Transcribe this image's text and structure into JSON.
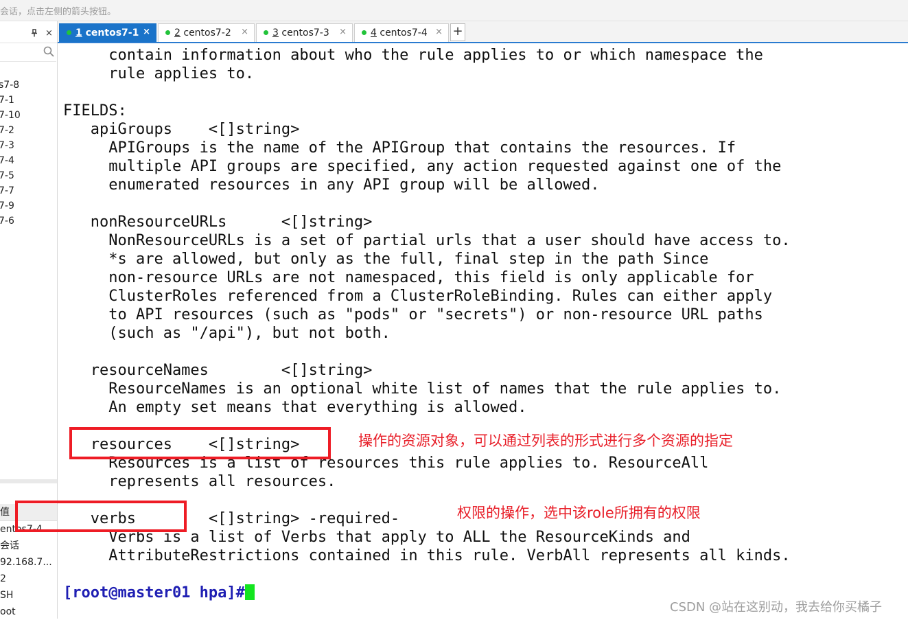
{
  "top_hint": "会话，点击左侧的箭头按钮。",
  "sidebar": {
    "pin_icon": "pin-icon",
    "close_label": "×",
    "search_icon": "search-icon",
    "items": [
      "s7-8",
      "7-1",
      "7-10",
      "7-2",
      "7-3",
      "7-4",
      "7-5",
      "7-7",
      "7-9",
      "7-6"
    ],
    "properties": [
      "值",
      "entos7-4",
      "会话",
      "92.168.7...",
      "2",
      "SH",
      "oot"
    ]
  },
  "tabs": [
    {
      "num": "1",
      "label": " centos7-1",
      "active": true,
      "close": "×"
    },
    {
      "num": "2",
      "label": " centos7-2",
      "active": false,
      "close": "×"
    },
    {
      "num": "3",
      "label": " centos7-3",
      "active": false,
      "close": "×"
    },
    {
      "num": "4",
      "label": " centos7-4",
      "active": false,
      "close": "×"
    }
  ],
  "tab_add_label": "+",
  "terminal": {
    "lines": [
      "     contain information about who the rule applies to or which namespace the",
      "     rule applies to.",
      "",
      "FIELDS:",
      "   apiGroups    <[]string>",
      "     APIGroups is the name of the APIGroup that contains the resources. If",
      "     multiple API groups are specified, any action requested against one of the",
      "     enumerated resources in any API group will be allowed.",
      "",
      "   nonResourceURLs      <[]string>",
      "     NonResourceURLs is a set of partial urls that a user should have access to.",
      "     *s are allowed, but only as the full, final step in the path Since",
      "     non-resource URLs are not namespaced, this field is only applicable for",
      "     ClusterRoles referenced from a ClusterRoleBinding. Rules can either apply",
      "     to API resources (such as \"pods\" or \"secrets\") or non-resource URL paths",
      "     (such as \"/api\"), but not both.",
      "",
      "   resourceNames        <[]string>",
      "     ResourceNames is an optional white list of names that the rule applies to.",
      "     An empty set means that everything is allowed.",
      "",
      "   resources    <[]string>",
      "     Resources is a list of resources this rule applies to. ResourceAll",
      "     represents all resources.",
      "",
      "   verbs        <[]string> -required-",
      "     Verbs is a list of Verbs that apply to ALL the ResourceKinds and",
      "     AttributeRestrictions contained in this rule. VerbAll represents all kinds.",
      ""
    ],
    "prompt": "[root@master01 hpa]#"
  },
  "annotations": {
    "resources_note": "操作的资源对象，可以通过列表的形式进行多个资源的指定",
    "verbs_note": "权限的操作，选中该role所拥有的权限"
  },
  "watermark": "CSDN @站在这别动，我去给你买橘子",
  "colors": {
    "accent": "#1a73c9",
    "annotation_red": "#ee1c25",
    "cursor_green": "#13e51f",
    "prompt_blue": "#1f1fb3"
  }
}
